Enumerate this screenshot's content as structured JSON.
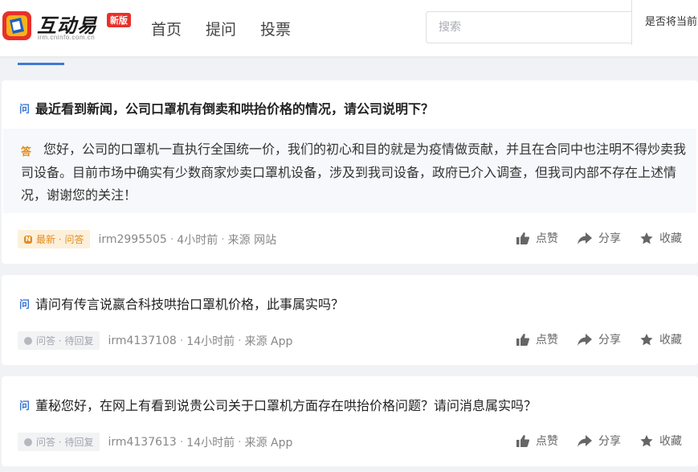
{
  "header": {
    "logo_text": "互动易",
    "logo_sub": "irm.cninfo.com.cn",
    "badge": "新版",
    "nav": [
      "首页",
      "提问",
      "投票"
    ],
    "search_placeholder": "搜索",
    "company_select": "是否将当前"
  },
  "colors": {
    "accent": "#3f7ad6",
    "answer": "#e38b1c",
    "brand_red": "#e8302a"
  },
  "posts": [
    {
      "q_mark": "问",
      "question": "最近看到新闻，公司口罩机有倒卖和哄抬价格的情况，请公司说明下？",
      "a_mark": "答",
      "answer": "您好，公司的口罩机一直执行全国统一价，我们的初心和目的就是为疫情做贡献，并且在合同中也注明不得炒卖我司设备。目前市场中确实有少数商家炒卖口罩机设备，涉及到我司设备，政府已介入调查，但我司内部不存在上述情况，谢谢您的关注！",
      "tag": "最新 · 问答",
      "user": "irm2995505",
      "time": "4小时前",
      "source": "来源 网站",
      "like": "点赞",
      "share": "分享",
      "collect": "收藏"
    },
    {
      "q_mark": "问",
      "question": "请问有传言说嬴合科技哄抬口罩机价格，此事属实吗？",
      "tag": "问答 · 待回复",
      "user": "irm4137108",
      "time": "14小时前",
      "source": "来源 App",
      "like": "点赞",
      "share": "分享",
      "collect": "收藏"
    },
    {
      "q_mark": "问",
      "question": "董秘您好，在网上有看到说贵公司关于口罩机方面存在哄抬价格问题？请问消息属实吗？",
      "tag": "问答 · 待回复",
      "user": "irm4137613",
      "time": "14小时前",
      "source": "来源 App",
      "like": "点赞",
      "share": "分享",
      "collect": "收藏"
    }
  ]
}
